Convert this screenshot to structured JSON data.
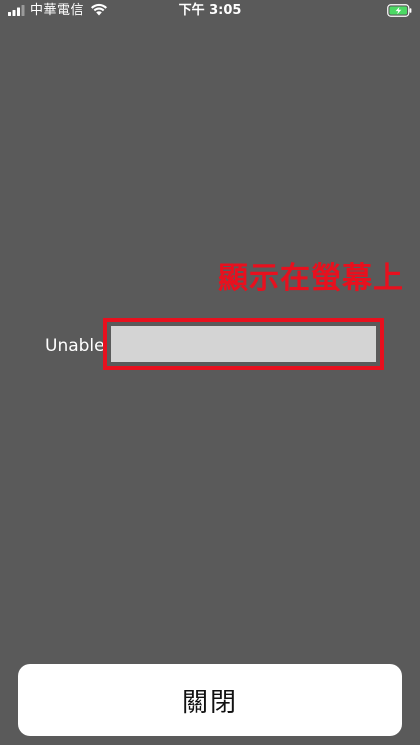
{
  "status_bar": {
    "carrier": "中華電信",
    "time": "下午 3:05",
    "signal_icon": "cellular-signal-icon",
    "wifi_icon": "wifi-icon",
    "battery_icon": "battery-charging-icon"
  },
  "annotation": {
    "label": "顯示在螢幕上",
    "color": "#e8101e"
  },
  "message": {
    "text": "Unable"
  },
  "close_button": {
    "label": "關閉"
  },
  "colors": {
    "background": "#5a5a5a",
    "highlight": "#e8101e",
    "redacted": "#d4d4d4",
    "battery": "#4cd964"
  }
}
